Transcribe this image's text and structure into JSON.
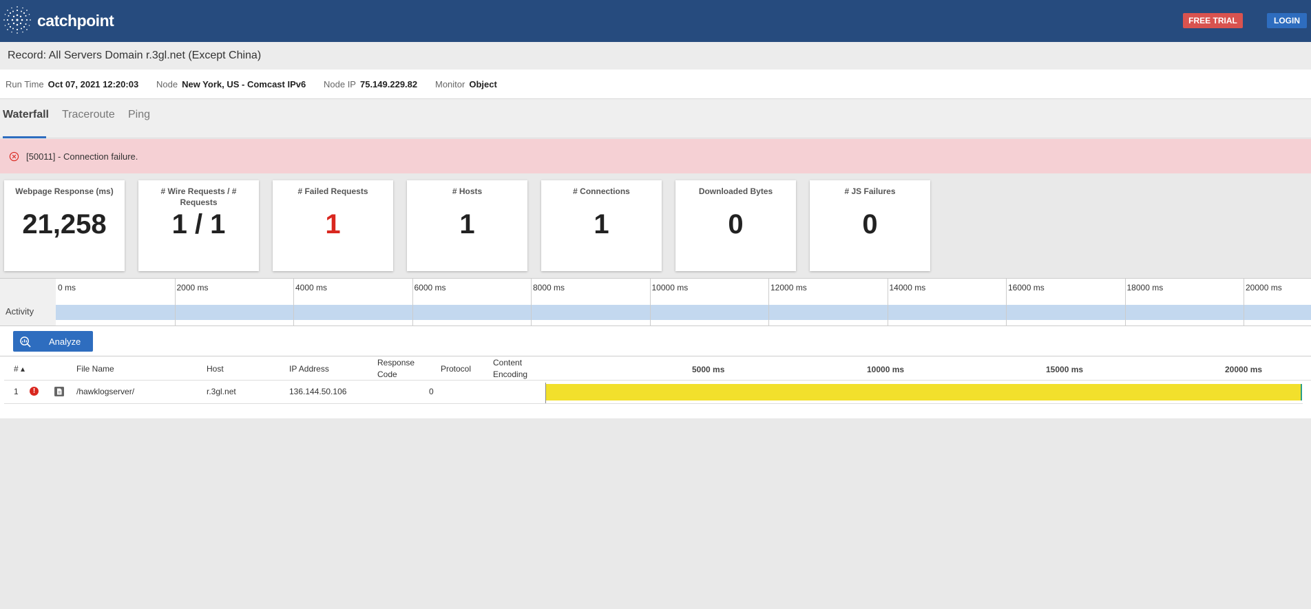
{
  "header": {
    "brand": "catchpoint",
    "free_trial": "FREE TRIAL",
    "login": "LOGIN",
    "brand_color": "#264b7e"
  },
  "record": {
    "title": "Record: All Servers Domain r.3gl.net (Except China)"
  },
  "meta": {
    "run_time_label": "Run Time",
    "run_time": "Oct 07, 2021 12:20:03",
    "node_label": "Node",
    "node": "New York, US - Comcast IPv6",
    "node_ip_label": "Node IP",
    "node_ip": "75.149.229.82",
    "monitor_label": "Monitor",
    "monitor": "Object"
  },
  "tabs": [
    {
      "label": "Waterfall",
      "active": true
    },
    {
      "label": "Traceroute",
      "active": false
    },
    {
      "label": "Ping",
      "active": false
    }
  ],
  "error": {
    "message": "[50011] - Connection failure.",
    "icon": "close-circle-icon"
  },
  "metrics": [
    {
      "label": "Webpage Response (ms)",
      "value": "21,258"
    },
    {
      "label": "# Wire Requests / # Requests",
      "value": "1 / 1"
    },
    {
      "label": "# Failed Requests",
      "value": "1",
      "color": "#d9271f"
    },
    {
      "label": "# Hosts",
      "value": "1"
    },
    {
      "label": "# Connections",
      "value": "1"
    },
    {
      "label": "Downloaded Bytes",
      "value": "0"
    },
    {
      "label": "# JS Failures",
      "value": "0"
    }
  ],
  "timeline": {
    "row_label": "Activity",
    "ticks": [
      "0 ms",
      "2000 ms",
      "4000 ms",
      "6000 ms",
      "8000 ms",
      "10000 ms",
      "12000 ms",
      "14000 ms",
      "16000 ms",
      "18000 ms",
      "20000 ms"
    ]
  },
  "analyze": {
    "label": "Analyze"
  },
  "table": {
    "headers": {
      "num": "# ▴",
      "file_name": "File Name",
      "host": "Host",
      "ip": "IP Address",
      "response_code": "Response Code",
      "protocol": "Protocol",
      "content_encoding": "Content Encoding"
    },
    "scale": [
      "5000 ms",
      "10000 ms",
      "15000 ms",
      "20000 ms"
    ],
    "rows": [
      {
        "num": "1",
        "file_name": "/hawklogserver/",
        "host": "r.3gl.net",
        "ip": "136.144.50.106",
        "response_code": "0",
        "protocol": "",
        "content_encoding": "",
        "duration_ms": 21258
      }
    ]
  }
}
